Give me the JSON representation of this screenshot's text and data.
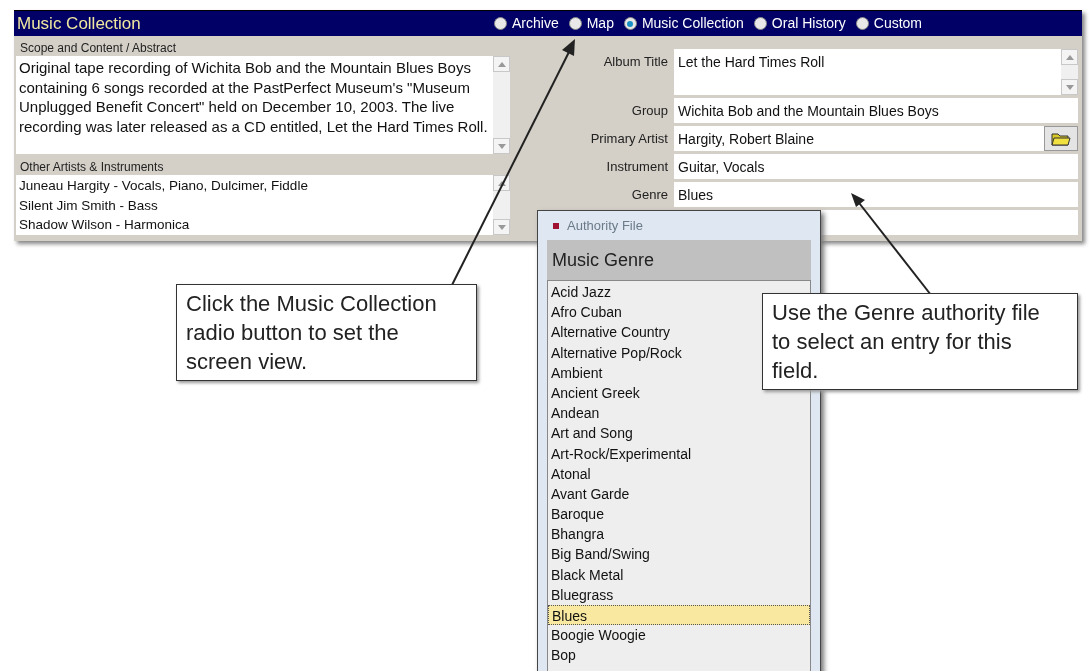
{
  "header": {
    "title": "Music Collection",
    "views": [
      {
        "label": "Archive",
        "selected": false
      },
      {
        "label": "Map",
        "selected": false
      },
      {
        "label": "Music Collection",
        "selected": true
      },
      {
        "label": "Oral History",
        "selected": false
      },
      {
        "label": "Custom",
        "selected": false
      }
    ]
  },
  "scope": {
    "label": "Scope and Content / Abstract",
    "text": "Original tape recording of Wichita Bob and the Mountain Blues Boys containing 6 songs recorded at the PastPerfect Museum's \"Museum Unplugged Benefit Concert\" held on December 10, 2003. The live recording was later released as a CD entitled, Let the Hard Times Roll."
  },
  "other_artists": {
    "label": "Other Artists & Instruments",
    "lines": [
      "Juneau Hargity - Vocals, Piano, Dulcimer, Fiddle",
      "Silent Jim Smith - Bass",
      "Shadow Wilson - Harmonica"
    ]
  },
  "fields": [
    {
      "label": "Album Title",
      "value": "Let the Hard Times Roll",
      "kind": "multiline"
    },
    {
      "label": "Group",
      "value": "Wichita Bob and the Mountain Blues Boys",
      "kind": "text"
    },
    {
      "label": "Primary Artist",
      "value": "Hargity, Robert Blaine",
      "kind": "lookup"
    },
    {
      "label": "Instrument",
      "value": "Guitar, Vocals",
      "kind": "text"
    },
    {
      "label": "Genre",
      "value": "Blues",
      "kind": "text"
    }
  ],
  "authority_file": {
    "title": "Authority File",
    "heading": "Music Genre",
    "items": [
      {
        "label": "Acid Jazz",
        "selected": false
      },
      {
        "label": "Afro Cuban",
        "selected": false
      },
      {
        "label": "Alternative Country",
        "selected": false
      },
      {
        "label": "Alternative Pop/Rock",
        "selected": false
      },
      {
        "label": "Ambient",
        "selected": false
      },
      {
        "label": "Ancient Greek",
        "selected": false
      },
      {
        "label": "Andean",
        "selected": false
      },
      {
        "label": "Art and Song",
        "selected": false
      },
      {
        "label": "Art-Rock/Experimental",
        "selected": false
      },
      {
        "label": "Atonal",
        "selected": false
      },
      {
        "label": "Avant Garde",
        "selected": false
      },
      {
        "label": "Baroque",
        "selected": false
      },
      {
        "label": "Bhangra",
        "selected": false
      },
      {
        "label": "Big Band/Swing",
        "selected": false
      },
      {
        "label": "Black Metal",
        "selected": false
      },
      {
        "label": "Bluegrass",
        "selected": false
      },
      {
        "label": "Blues",
        "selected": true
      },
      {
        "label": "Boogie Woogie",
        "selected": false
      },
      {
        "label": "Bop",
        "selected": false
      }
    ]
  },
  "callouts": [
    "Click the Music Collection radio button to set the screen view.",
    "Use the Genre authority file to select an entry for this field."
  ]
}
